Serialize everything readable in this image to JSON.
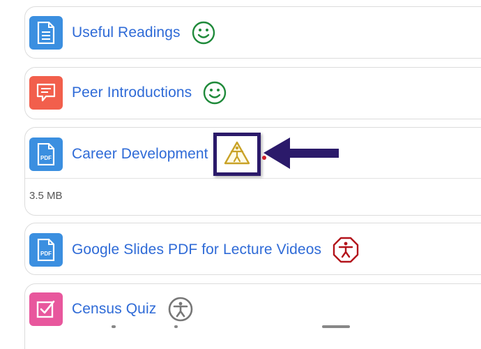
{
  "items": [
    {
      "title": "Useful Readings",
      "type_icon": "document-icon",
      "type_color": "#3b8fe0",
      "status_icon": "smiley-icon",
      "status_color": "#1f8a3a"
    },
    {
      "title": "Peer Introductions",
      "type_icon": "discussion-icon",
      "type_color": "#f25f4c",
      "status_icon": "smiley-icon",
      "status_color": "#1f8a3a"
    },
    {
      "title": "Career Development",
      "type_icon": "pdf-icon",
      "type_icon_text": "PDF",
      "type_color": "#3b8fe0",
      "meta": "3.5 MB",
      "status_icon": "accessibility-warning-icon",
      "status_color": "#c9a227"
    },
    {
      "title": "Google Slides PDF for Lecture Videos",
      "type_icon": "pdf-icon",
      "type_icon_text": "PDF",
      "type_color": "#3b8fe0",
      "status_icon": "accessibility-alert-icon",
      "status_color": "#b3131b"
    },
    {
      "title": "Census Quiz",
      "type_icon": "quiz-checkbox-icon",
      "type_color": "#e8579d",
      "status_icon": "accessibility-neutral-icon",
      "status_color": "#777777"
    }
  ],
  "annotation": {
    "arrow_color": "#2b1a6a",
    "box_color": "#2b1a6a"
  }
}
